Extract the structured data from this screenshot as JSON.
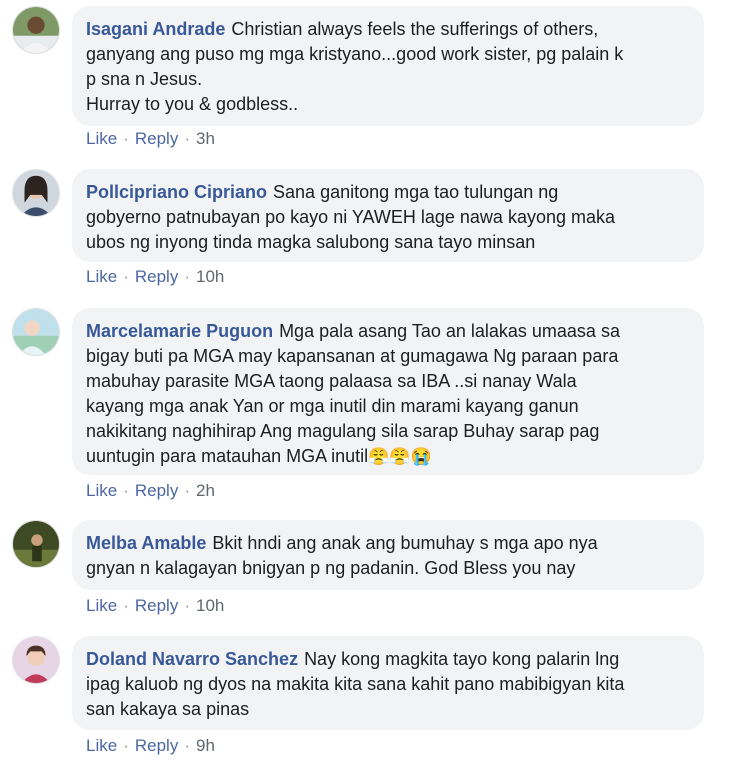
{
  "comments": [
    {
      "author": "Isagani Andrade",
      "text": "Christian always feels the sufferings of others, ganyang ang puso mg mga kristyano...good work sister, pg palain k p sna n Jesus. Hurray to you & godbless..",
      "lines": [
        "Christian always feels the sufferings of others,",
        "ganyang ang puso mg mga kristyano...good work sister, pg palain k",
        "p sna n Jesus.",
        "Hurray to you & godbless.."
      ],
      "like": "Like",
      "reply": "Reply",
      "time": "3h",
      "avatar_icon": "man-avatar-icon"
    },
    {
      "author": "Pollcipriano Cipriano",
      "lines": [
        "Sana ganitong mga tao tulungan ng",
        "gobyerno patnubayan po kayo ni YAWEH lage nawa kayong maka",
        "ubos ng inyong tinda magka salubong sana tayo minsan"
      ],
      "like": "Like",
      "reply": "Reply",
      "time": "10h",
      "avatar_icon": "woman-avatar-icon"
    },
    {
      "author": "Marcelamarie Puguon",
      "lines": [
        "Mga pala asang Tao an lalakas umaasa sa",
        "bigay buti pa MGA may kapansanan at gumagawa Ng paraan para",
        "mabuhay parasite MGA taong palaasa sa IBA ..si nanay Wala",
        "kayang mga anak Yan or mga inutil din marami kayang ganun",
        "nakikitang naghihirap Ang magulang sila sarap Buhay sarap pag",
        "uuntugin para matauhan MGA inutil"
      ],
      "emojis": [
        "😤",
        "😤",
        "😭"
      ],
      "like": "Like",
      "reply": "Reply",
      "time": "2h",
      "avatar_icon": "landscape-avatar-icon"
    },
    {
      "author": "Melba Amable",
      "lines": [
        "Bkit hndi ang anak ang bumuhay s mga apo nya",
        "gnyan n kalagayan bnigyan p ng padanin. God Bless you nay"
      ],
      "like": "Like",
      "reply": "Reply",
      "time": "10h",
      "avatar_icon": "outdoor-avatar-icon"
    },
    {
      "author": "Doland Navarro Sanchez",
      "lines": [
        "Nay kong magkita tayo kong palarin lng",
        "ipag kaluob ng dyos na makita kita sana kahit pano mabibigyan kita",
        "san kakaya sa pinas"
      ],
      "like": "Like",
      "reply": "Reply",
      "time": "9h",
      "avatar_icon": "child-avatar-icon"
    }
  ],
  "colors": {
    "author": "#385898",
    "link": "#4b67a1",
    "bubble": "#f2f3f5",
    "text": "#1c1e21",
    "meta": "#606770"
  }
}
